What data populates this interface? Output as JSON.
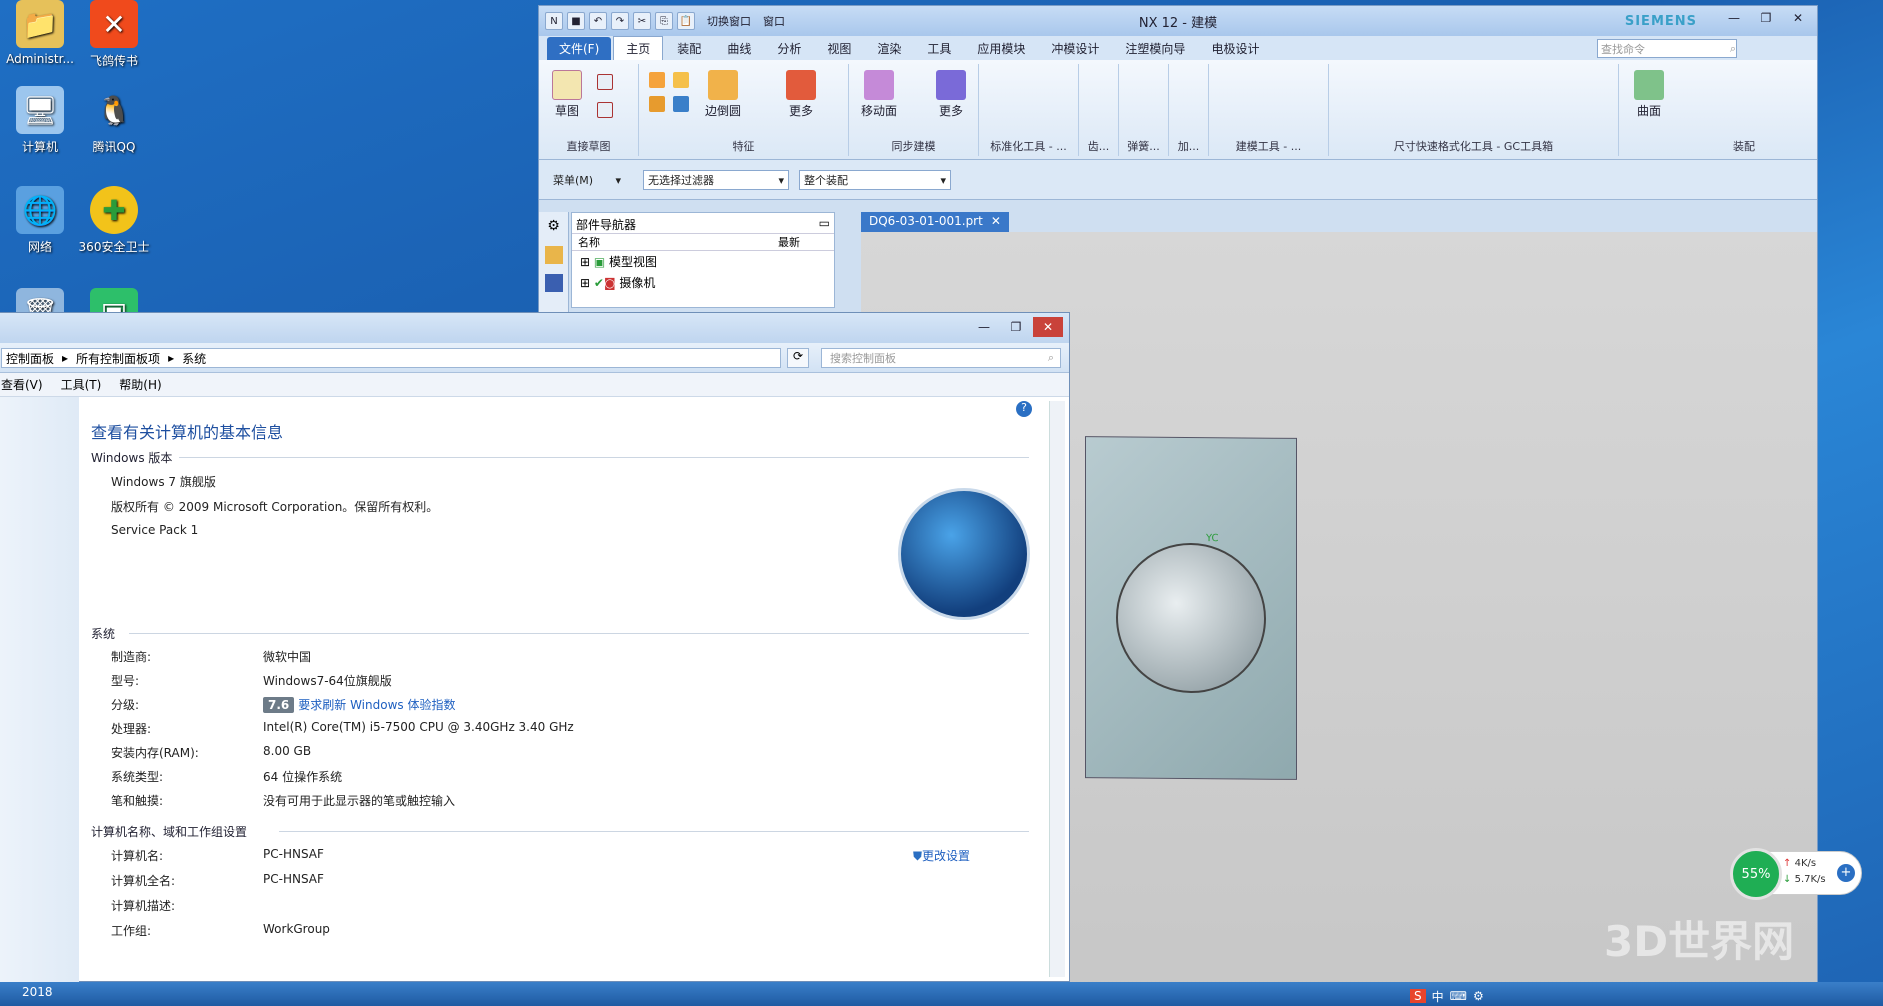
{
  "desktop": {
    "icons": [
      {
        "label": "Administr...",
        "icon": "folder-user-icon"
      },
      {
        "label": "飞鸽传书",
        "icon": "feige-icon"
      },
      {
        "label": "计算机",
        "icon": "computer-icon"
      },
      {
        "label": "腾讯QQ",
        "icon": "qq-icon"
      },
      {
        "label": "网络",
        "icon": "network-icon"
      },
      {
        "label": "360安全卫士",
        "icon": "360-icon"
      }
    ],
    "taskbar_year": "2018"
  },
  "nx": {
    "title": "NX 12 - 建模",
    "brand": "SIEMENS",
    "quick_access": [
      "切换窗口",
      "窗口"
    ],
    "tabs": [
      "文件(F)",
      "主页",
      "装配",
      "曲线",
      "分析",
      "视图",
      "渲染",
      "工具",
      "应用模块",
      "冲模设计",
      "注塑模向导",
      "电极设计"
    ],
    "search_placeholder": "查找命令",
    "groups": [
      "直接草图",
      "特征",
      "同步建模",
      "标准化工具 - ...",
      "齿...",
      "弹簧...",
      "加...",
      "建模工具 - ...",
      "尺寸快速格式化工具 - GC工具箱",
      "装配"
    ],
    "buttons": {
      "sketch": "草图",
      "edge_blend": "边倒圆",
      "more": "更多",
      "move_face": "移动面",
      "more2": "更多",
      "surface": "曲面"
    },
    "menu_label": "菜单(M)",
    "filter": "无选择过滤器",
    "assembly_scope": "整个装配",
    "nav": {
      "title": "部件导航器",
      "col_name": "名称",
      "col_latest": "最新",
      "items": [
        "模型视图",
        "摄像机"
      ]
    },
    "doc_tab": "DQ6-03-01-001.prt"
  },
  "cp": {
    "breadcrumb": [
      "控制面板",
      "所有控制面板项",
      "系统"
    ],
    "search_placeholder": "搜索控制面板",
    "menu": [
      "查看(V)",
      "工具(T)",
      "帮助(H)"
    ],
    "heading": "查看有关计算机的基本信息",
    "win_section": "Windows 版本",
    "edition": "Windows 7 旗舰版",
    "copyright": "版权所有 © 2009 Microsoft Corporation。保留所有权利。",
    "sp": "Service Pack 1",
    "sys_section": "系统",
    "sys_rows": [
      {
        "k": "制造商:",
        "v": "微软中国"
      },
      {
        "k": "型号:",
        "v": "Windows7-64位旗舰版"
      },
      {
        "k": "分级:",
        "v": "要求刷新 Windows 体验指数",
        "badge": "7.6"
      },
      {
        "k": "处理器:",
        "v": "Intel(R) Core(TM) i5-7500 CPU @ 3.40GHz   3.40 GHz"
      },
      {
        "k": "安装内存(RAM):",
        "v": "8.00 GB"
      },
      {
        "k": "系统类型:",
        "v": "64 位操作系统"
      },
      {
        "k": "笔和触摸:",
        "v": "没有可用于此显示器的笔或触控输入"
      }
    ],
    "name_section": "计算机名称、域和工作组设置",
    "name_rows": [
      {
        "k": "计算机名:",
        "v": "PC-HNSAF"
      },
      {
        "k": "计算机全名:",
        "v": "PC-HNSAF"
      },
      {
        "k": "计算机描述:",
        "v": ""
      },
      {
        "k": "工作组:",
        "v": "WorkGroup"
      }
    ],
    "change_settings": "更改设置"
  },
  "widget": {
    "percent": "55%",
    "up": "4K/s",
    "down": "5.7K/s"
  },
  "watermark": "3D世界网"
}
